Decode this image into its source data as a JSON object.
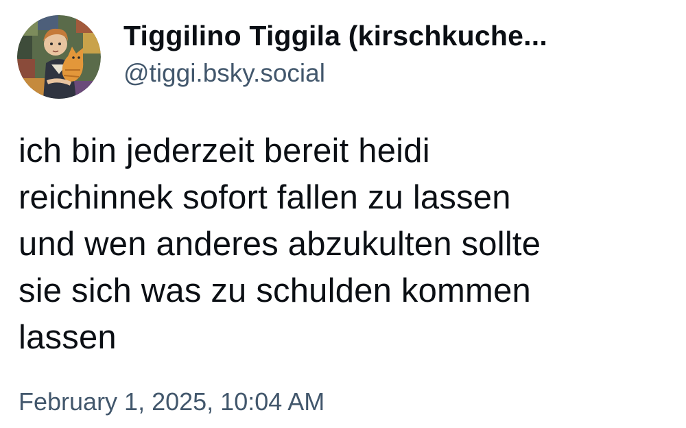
{
  "post": {
    "author": {
      "display_name": "Tiggilino Tiggila (kirschkuche...",
      "handle": "@tiggi.bsky.social",
      "avatar_icon": "painted-portrait-with-cat-avatar"
    },
    "text": "ich bin jederzeit bereit heidi\nreichinnek sofort fallen zu lassen\nund wen anderes abzukulten sollte\nsie sich was zu schulden kommen\nlassen",
    "timestamp": "February 1, 2025, 10:04 AM"
  },
  "colors": {
    "background": "#ffffff",
    "text_primary": "#0b0f14",
    "text_secondary": "#42576c"
  }
}
